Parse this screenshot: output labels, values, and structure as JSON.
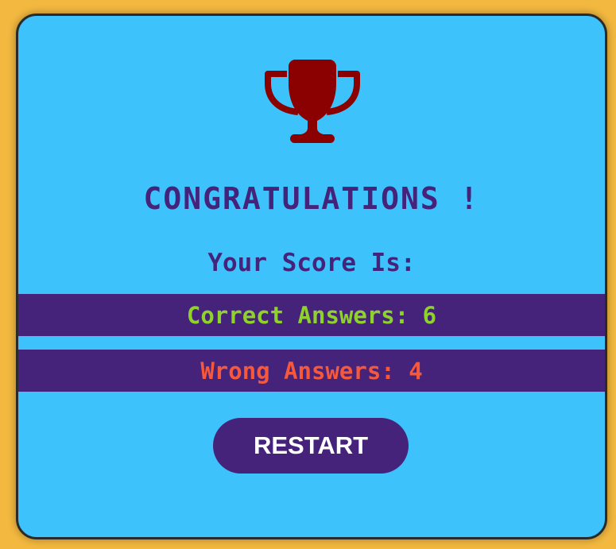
{
  "result": {
    "icon": "trophy-icon",
    "heading": "CONGRATULATIONS !",
    "score_label": "Your Score Is:",
    "correct_text": "Correct Answers: 6",
    "wrong_text": "Wrong Answers: 4",
    "correct_count": 6,
    "wrong_count": 4,
    "restart_label": "RESTART"
  },
  "colors": {
    "page_background": "#f2b83f",
    "card_background": "#3dc2fc",
    "accent_purple": "#45237a",
    "trophy": "#8b0000",
    "correct": "#8fd22a",
    "wrong": "#f5583b",
    "button_text": "#ffffff"
  }
}
